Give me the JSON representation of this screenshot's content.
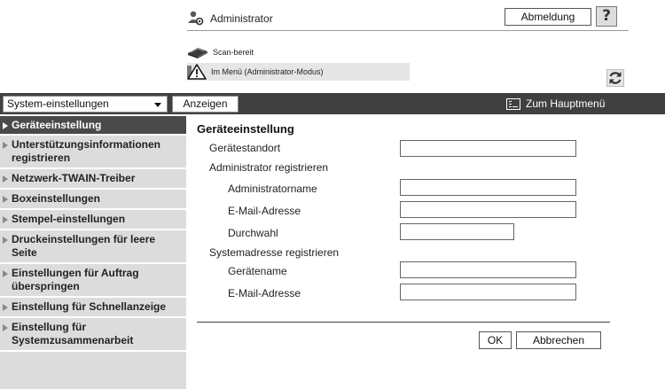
{
  "header": {
    "user_label": "Administrator",
    "logout_label": "Abmeldung",
    "help_label": "?",
    "status_text": "Scan-bereit",
    "mode_text": "Im Menü (Administrator-Modus)"
  },
  "toolbar": {
    "category_select": "System-einstellungen",
    "show_label": "Anzeigen",
    "main_menu_label": "Zum Hauptmenü"
  },
  "sidebar": {
    "items": [
      {
        "label": "Geräteeinstellung"
      },
      {
        "label": "Unterstützungsinformationen registrieren"
      },
      {
        "label": "Netzwerk-TWAIN-Treiber"
      },
      {
        "label": "Boxeinstellungen"
      },
      {
        "label": "Stempel-einstellungen"
      },
      {
        "label": "Druckeinstellungen für leere Seite"
      },
      {
        "label": "Einstellungen für Auftrag überspringen"
      },
      {
        "label": "Einstellung für Schnellanzeige"
      },
      {
        "label": "Einstellung für Systemzusammenarbeit"
      }
    ]
  },
  "form": {
    "title": "Geräteeinstellung",
    "location_label": "Gerätestandort",
    "admin_section": "Administrator registrieren",
    "admin_name_label": "Administratorname",
    "admin_email_label": "E-Mail-Adresse",
    "extension_label": "Durchwahl",
    "system_section": "Systemadresse registrieren",
    "device_name_label": "Gerätename",
    "system_email_label": "E-Mail-Adresse",
    "ok_label": "OK",
    "cancel_label": "Abbrechen"
  }
}
